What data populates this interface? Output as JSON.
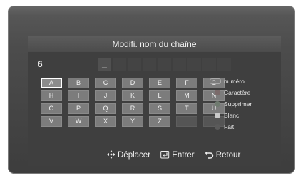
{
  "dialog": {
    "title": "Modifi. nom du chaîne",
    "channel_number": "6",
    "cursor": "_"
  },
  "keyboard": {
    "rows": [
      [
        "A",
        "B",
        "C",
        "D",
        "E",
        "F",
        "G"
      ],
      [
        "H",
        "I",
        "J",
        "K",
        "L",
        "M",
        "N"
      ],
      [
        "O",
        "P",
        "Q",
        "R",
        "S",
        "T",
        "U"
      ],
      [
        "V",
        "W",
        "X",
        "Y",
        "Z",
        "",
        ""
      ]
    ],
    "selected": "A"
  },
  "legend": [
    {
      "icon": "number-keys-icon",
      "label": "numéro"
    },
    {
      "icon": "red-button-icon",
      "label": "Caractère"
    },
    {
      "icon": "green-button-icon",
      "label": "Supprimer"
    },
    {
      "icon": "yellow-button-icon",
      "label": "Blanc"
    },
    {
      "icon": "blue-button-icon",
      "label": "Fait"
    }
  ],
  "footer": {
    "move_label": "Déplacer",
    "enter_label": "Entrer",
    "return_label": "Retour"
  }
}
